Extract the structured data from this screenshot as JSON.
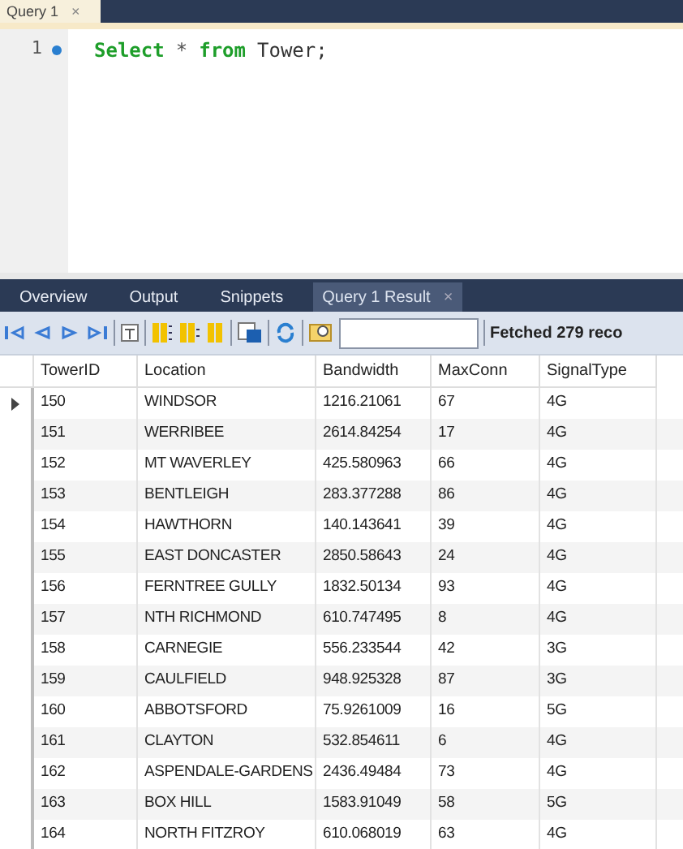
{
  "editor_tab": {
    "label": "Query 1",
    "close": "×"
  },
  "editor": {
    "lines": [
      {
        "number": "1",
        "marked": true,
        "tokens": [
          {
            "kind": "keyword",
            "text": "Select"
          },
          {
            "kind": "operator",
            "text": "*"
          },
          {
            "kind": "keyword",
            "text": "from"
          },
          {
            "kind": "plain",
            "text": "Tower;"
          }
        ]
      }
    ]
  },
  "result_tabs": [
    {
      "label": "Overview",
      "selected": false
    },
    {
      "label": "Output",
      "selected": false
    },
    {
      "label": "Snippets",
      "selected": false
    },
    {
      "label": "Query 1 Result",
      "selected": true,
      "close": "×"
    }
  ],
  "toolbar": {
    "status": "Fetched 279 reco"
  },
  "table": {
    "columns": [
      "TowerID",
      "Location",
      "Bandwidth",
      "MaxConn",
      "SignalType"
    ],
    "rows": [
      {
        "selected": true,
        "cells": [
          "150",
          "WINDSOR",
          "1216.21061",
          "67",
          "4G"
        ]
      },
      {
        "selected": false,
        "cells": [
          "151",
          "WERRIBEE",
          "2614.84254",
          "17",
          "4G"
        ]
      },
      {
        "selected": false,
        "cells": [
          "152",
          "MT WAVERLEY",
          "425.580963",
          "66",
          "4G"
        ]
      },
      {
        "selected": false,
        "cells": [
          "153",
          "BENTLEIGH",
          "283.377288",
          "86",
          "4G"
        ]
      },
      {
        "selected": false,
        "cells": [
          "154",
          "HAWTHORN",
          "140.143641",
          "39",
          "4G"
        ]
      },
      {
        "selected": false,
        "cells": [
          "155",
          "EAST DONCASTER",
          "2850.58643",
          "24",
          "4G"
        ]
      },
      {
        "selected": false,
        "cells": [
          "156",
          "FERNTREE GULLY",
          "1832.50134",
          "93",
          "4G"
        ]
      },
      {
        "selected": false,
        "cells": [
          "157",
          "NTH RICHMOND",
          "610.747495",
          "8",
          "4G"
        ]
      },
      {
        "selected": false,
        "cells": [
          "158",
          "CARNEGIE",
          "556.233544",
          "42",
          "3G"
        ]
      },
      {
        "selected": false,
        "cells": [
          "159",
          "CAULFIELD",
          "948.925328",
          "87",
          "3G"
        ]
      },
      {
        "selected": false,
        "cells": [
          "160",
          "ABBOTSFORD",
          "75.9261009",
          "16",
          "5G"
        ]
      },
      {
        "selected": false,
        "cells": [
          "161",
          "CLAYTON",
          "532.854611",
          "6",
          "4G"
        ]
      },
      {
        "selected": false,
        "cells": [
          "162",
          "ASPENDALE-GARDENS",
          "2436.49484",
          "73",
          "4G"
        ]
      },
      {
        "selected": false,
        "cells": [
          "163",
          "BOX HILL",
          "1583.91049",
          "58",
          "5G"
        ]
      },
      {
        "selected": false,
        "cells": [
          "164",
          "NORTH FITZROY",
          "610.068019",
          "63",
          "4G"
        ]
      }
    ]
  }
}
